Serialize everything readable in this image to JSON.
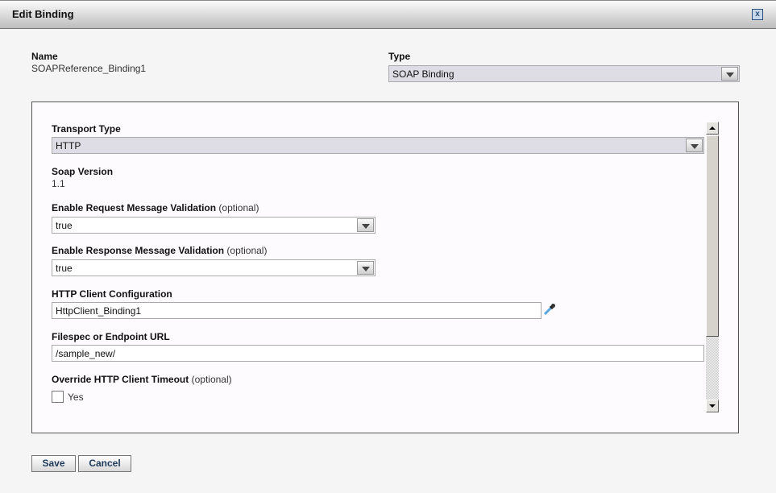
{
  "dialog": {
    "title": "Edit Binding",
    "close_icon": "close-icon"
  },
  "name": {
    "label": "Name",
    "value": "SOAPReference_Binding1"
  },
  "type": {
    "label": "Type",
    "value": "SOAP Binding"
  },
  "form": {
    "transport": {
      "label": "Transport Type",
      "value": "HTTP"
    },
    "soap_version": {
      "label": "Soap Version",
      "value": "1.1"
    },
    "req_validation": {
      "label": "Enable Request Message Validation",
      "optional": "(optional)",
      "value": "true"
    },
    "resp_validation": {
      "label": "Enable Response Message Validation",
      "optional": "(optional)",
      "value": "true"
    },
    "http_client": {
      "label": "HTTP Client Configuration",
      "value": "HttpClient_Binding1"
    },
    "endpoint": {
      "label": "Filespec or Endpoint URL",
      "value": "/sample_new/"
    },
    "override_timeout": {
      "label": "Override HTTP Client Timeout",
      "optional": "(optional)",
      "checkbox_label": "Yes",
      "checked": false
    }
  },
  "buttons": {
    "save": "Save",
    "cancel": "Cancel"
  }
}
